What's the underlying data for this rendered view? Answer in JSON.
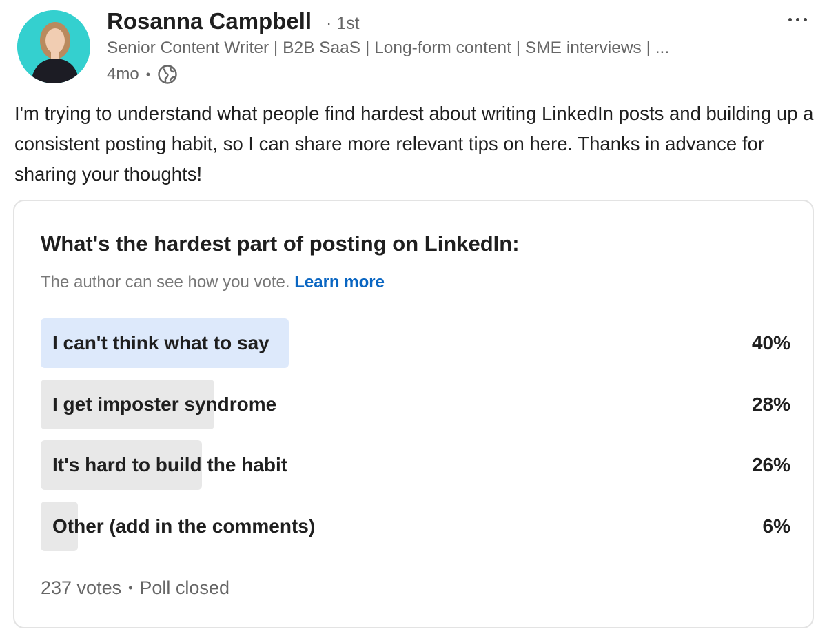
{
  "author": {
    "name": "Rosanna Campbell",
    "degree": "· 1st",
    "headline": "Senior Content Writer | B2B SaaS | Long-form content | SME interviews | ...",
    "time_ago": "4mo",
    "visibility_icon": "globe-icon"
  },
  "post": {
    "text": "I'm trying to understand what people find hardest about writing LinkedIn posts and building up a consistent posting habit, so I can share more relevant tips on here. Thanks in advance for sharing your thoughts!"
  },
  "poll": {
    "question": "What's the hardest part of posting on LinkedIn:",
    "note": "The author can see how you vote.",
    "learn_more": "Learn more",
    "options": [
      {
        "label": "I can't think what to say",
        "percent": "40%",
        "share": 0.4,
        "selected": true
      },
      {
        "label": "I get imposter syndrome",
        "percent": "28%",
        "share": 0.28,
        "selected": false
      },
      {
        "label": "It's hard to build the habit",
        "percent": "26%",
        "share": 0.26,
        "selected": false
      },
      {
        "label": "Other (add in the comments)",
        "percent": "6%",
        "share": 0.06,
        "selected": false
      }
    ],
    "votes": "237 votes",
    "status": "Poll closed"
  },
  "colors": {
    "avatar_bg": "#34d0cf",
    "link": "#0a66c2",
    "selected_bar": "#dde9fb",
    "bar": "#e8e8e8"
  }
}
